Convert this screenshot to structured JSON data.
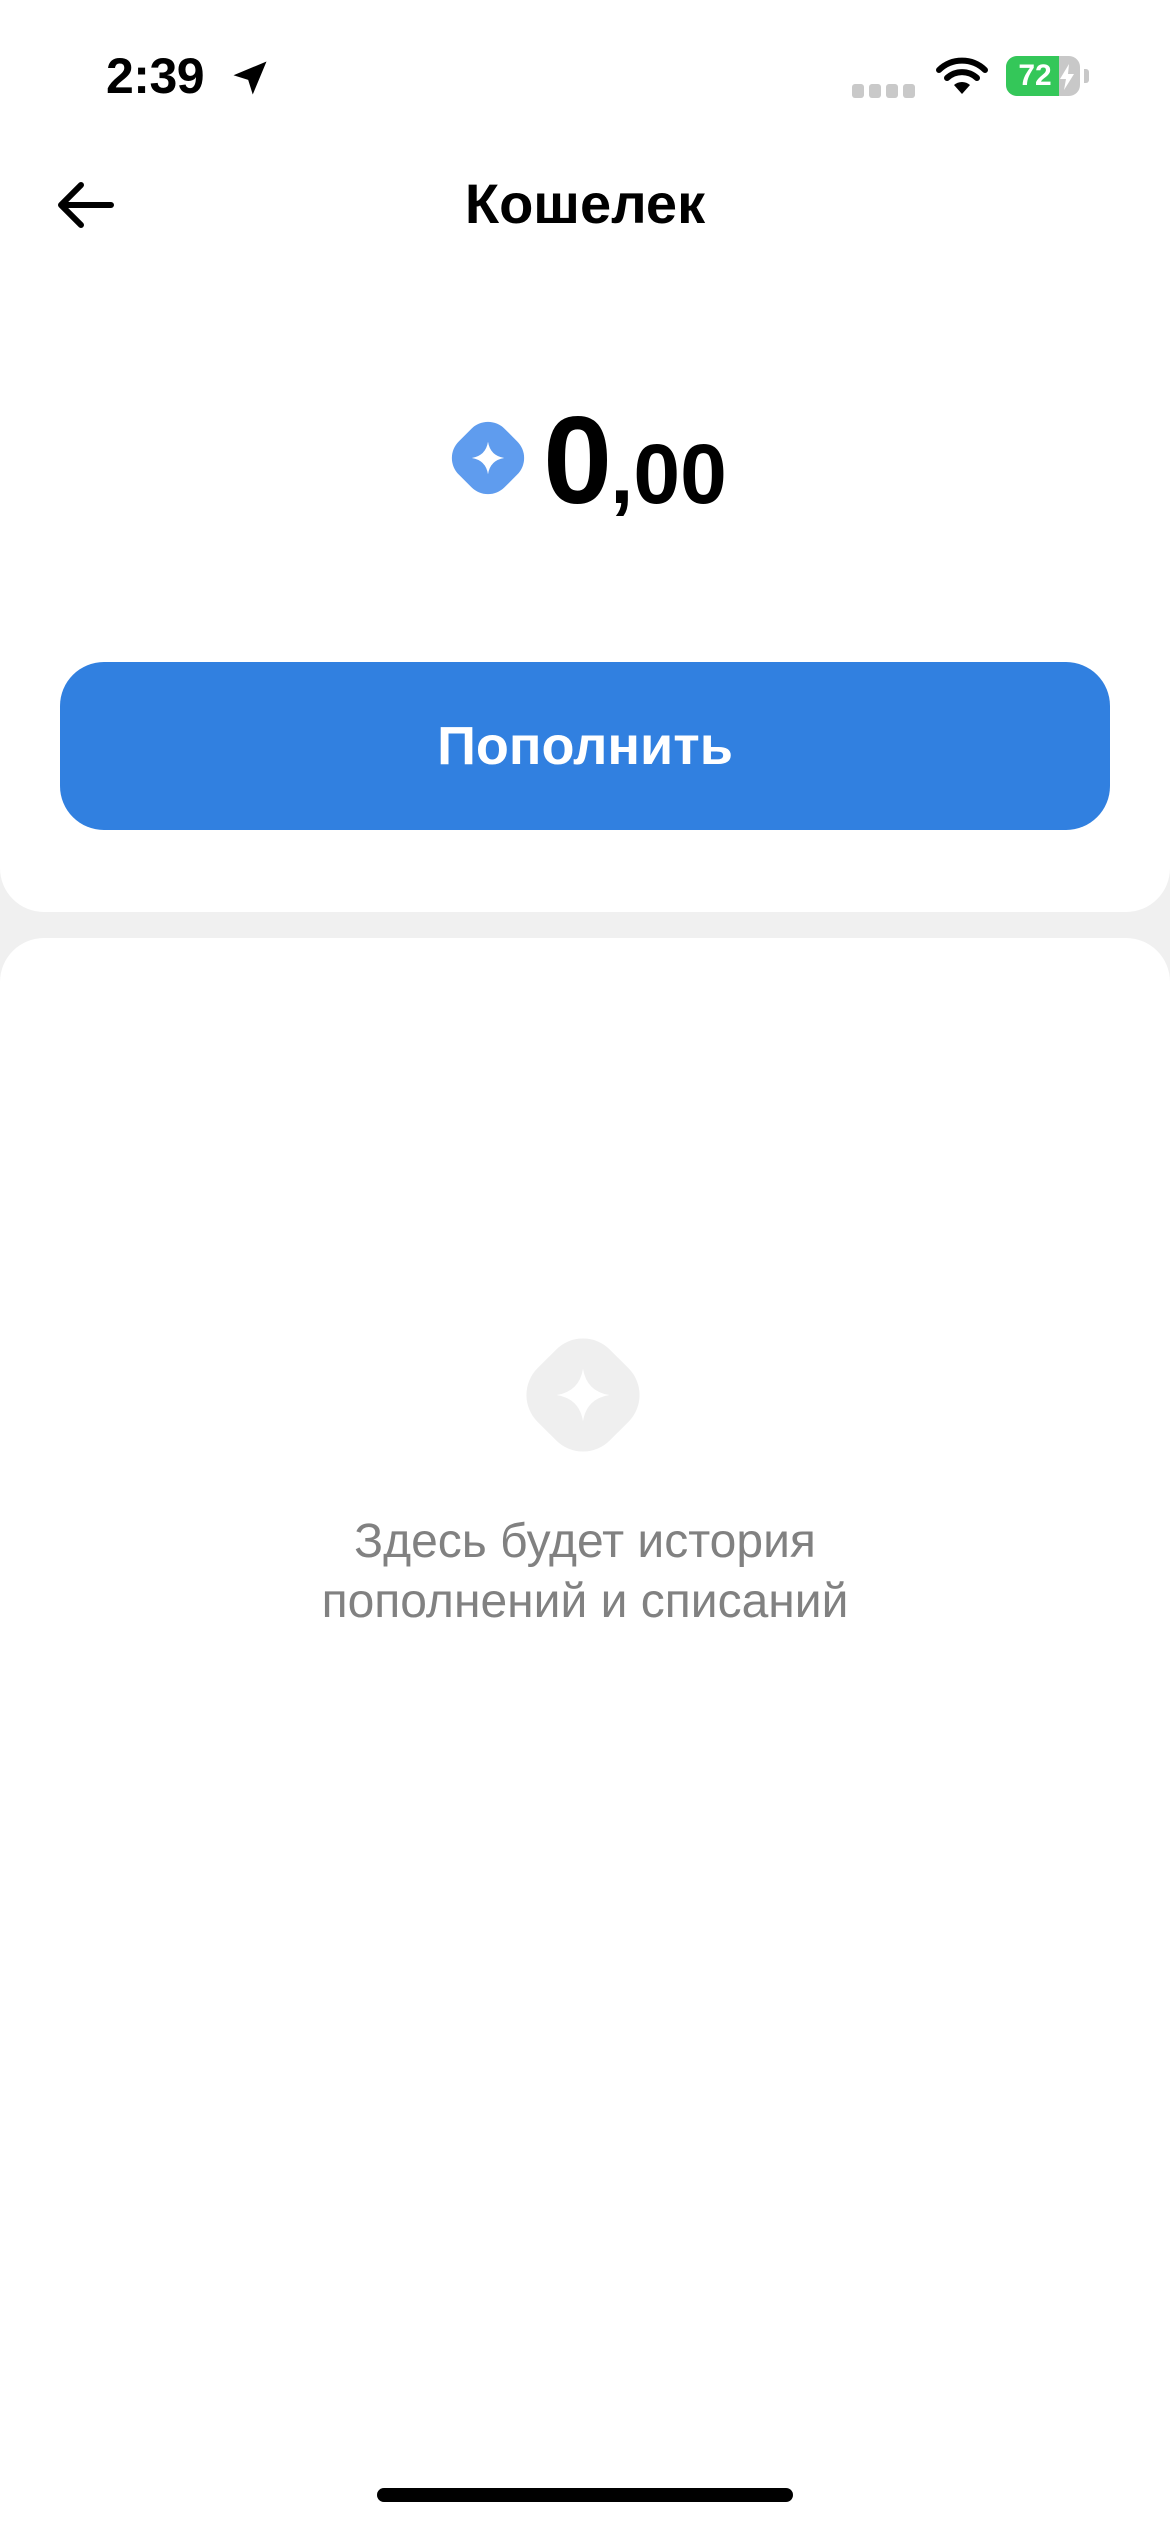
{
  "status_bar": {
    "time": "2:39",
    "battery_level": "72",
    "battery_fraction": 0.72,
    "battery_color": "#34c759",
    "icons": [
      "location-arrow-icon",
      "signal-icon",
      "wifi-icon",
      "battery-charging-icon"
    ]
  },
  "header": {
    "title": "Кошелек",
    "back_icon": "arrow-left-icon"
  },
  "balance": {
    "integer": "0",
    "fraction": ",00",
    "icon": "coin-icon",
    "icon_color": "#5f9cee"
  },
  "actions": {
    "topup_label": "Пополнить",
    "accent_color": "#3180e0"
  },
  "history": {
    "empty_icon": "coin-placeholder-icon",
    "empty_line1": "Здесь будет история",
    "empty_line2": "пополнений и списаний"
  }
}
